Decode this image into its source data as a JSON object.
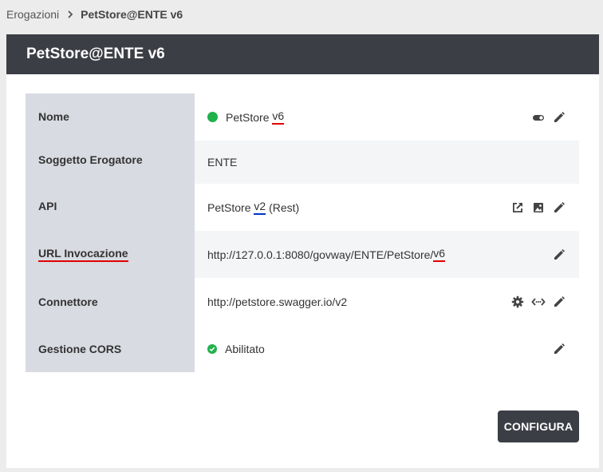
{
  "breadcrumb": {
    "parent": "Erogazioni",
    "current": "PetStore@ENTE v6"
  },
  "header": {
    "title": "PetStore@ENTE v6"
  },
  "rows": {
    "nome": {
      "label": "Nome",
      "name": "PetStore",
      "version": "v6",
      "status_color": "#21b14b"
    },
    "soggetto": {
      "label": "Soggetto Erogatore",
      "value": "ENTE"
    },
    "api": {
      "label": "API",
      "name": "PetStore",
      "version": "v2",
      "type": "(Rest)"
    },
    "url": {
      "label": "URL Invocazione",
      "prefix": "http://127.0.0.1:8080/govway/ENTE/PetStore/",
      "version": "v6"
    },
    "connettore": {
      "label": "Connettore",
      "value": "http://petstore.swagger.io/v2"
    },
    "cors": {
      "label": "Gestione CORS",
      "value": "Abilitato"
    }
  },
  "icons": {
    "nome": [
      "toggle-icon",
      "edit-icon"
    ],
    "api": [
      "open-external-icon",
      "image-icon",
      "edit-icon"
    ],
    "url": [
      "edit-icon"
    ],
    "connettore": [
      "gear-icon",
      "code-icon",
      "edit-icon"
    ],
    "cors": [
      "edit-icon"
    ]
  },
  "colors": {
    "header": "#3c3e45",
    "label_bg": "#d9dbe2",
    "alt_bg": "#f4f5f7",
    "status_green": "#21b14b",
    "underline_red": "#e10000",
    "underline_blue": "#0033cc"
  },
  "button": {
    "label": "CONFIGURA"
  }
}
